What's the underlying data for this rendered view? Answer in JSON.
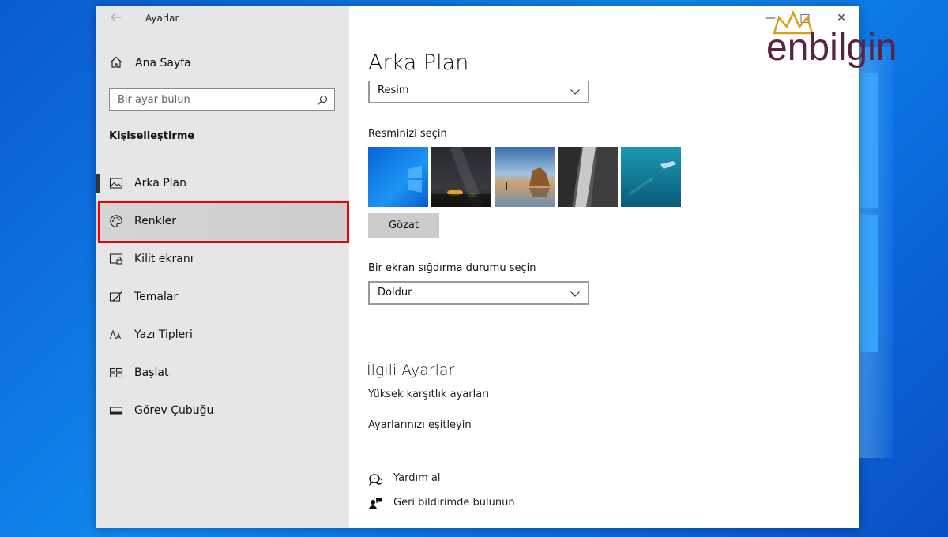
{
  "window": {
    "title": "Ayarlar"
  },
  "sidebar": {
    "home_label": "Ana Sayfa",
    "search_placeholder": "Bir ayar bulun",
    "section_title": "Kişiselleştirme",
    "items": [
      {
        "label": "Arka Plan",
        "icon": "image-icon",
        "active": true
      },
      {
        "label": "Renkler",
        "icon": "palette-icon",
        "highlighted": true
      },
      {
        "label": "Kilit ekranı",
        "icon": "lock-screen-icon"
      },
      {
        "label": "Temalar",
        "icon": "brush-icon"
      },
      {
        "label": "Yazı Tipleri",
        "icon": "font-icon"
      },
      {
        "label": "Başlat",
        "icon": "start-icon"
      },
      {
        "label": "Görev Çubuğu",
        "icon": "taskbar-icon"
      }
    ]
  },
  "main": {
    "title": "Arka Plan",
    "background_type": "Resim",
    "choose_picture_label": "Resminizi seçin",
    "pictures": [
      "windows-default",
      "night-sky",
      "beach-rocks",
      "waterfall-cliff",
      "underwater-swimmer"
    ],
    "browse_label": "Gözat",
    "fit_label": "Bir ekran sığdırma durumu seçin",
    "fit_value": "Doldur",
    "related_title": "İlgili Ayarlar",
    "related_links": [
      "Yüksek karşıtlık ayarları",
      "Ayarlarınızı eşitleyin"
    ],
    "help_label": "Yardım al",
    "feedback_label": "Geri bildirimde bulunun"
  },
  "logo": {
    "text": "enbilgin"
  },
  "colors": {
    "highlight_box": "#ef0000",
    "logo": "#5a2342",
    "logo_crown": "#d9a020"
  }
}
